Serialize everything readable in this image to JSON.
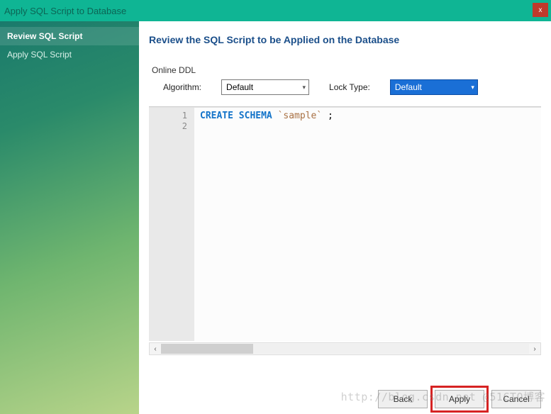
{
  "title": "Apply SQL Script to Database",
  "close_glyph": "x",
  "sidebar": {
    "items": [
      {
        "label": "Review SQL Script",
        "active": true
      },
      {
        "label": "Apply SQL Script",
        "active": false
      }
    ]
  },
  "main": {
    "heading": "Review the SQL Script to be Applied on the Database",
    "ddl": {
      "section_label": "Online DDL",
      "algorithm_label": "Algorithm:",
      "algorithm_value": "Default",
      "locktype_label": "Lock Type:",
      "locktype_value": "Default"
    },
    "editor": {
      "lines": [
        "1",
        "2"
      ],
      "sql_keyword": "CREATE SCHEMA",
      "sql_identifier": "`sample`",
      "sql_terminator": " ;"
    },
    "scroll": {
      "left_arrow": "‹",
      "right_arrow": "›"
    },
    "buttons": {
      "back": "Back",
      "apply": "Apply",
      "cancel": "Cancel"
    }
  },
  "watermark": "http://blog.csdn.net @51CTO博客"
}
